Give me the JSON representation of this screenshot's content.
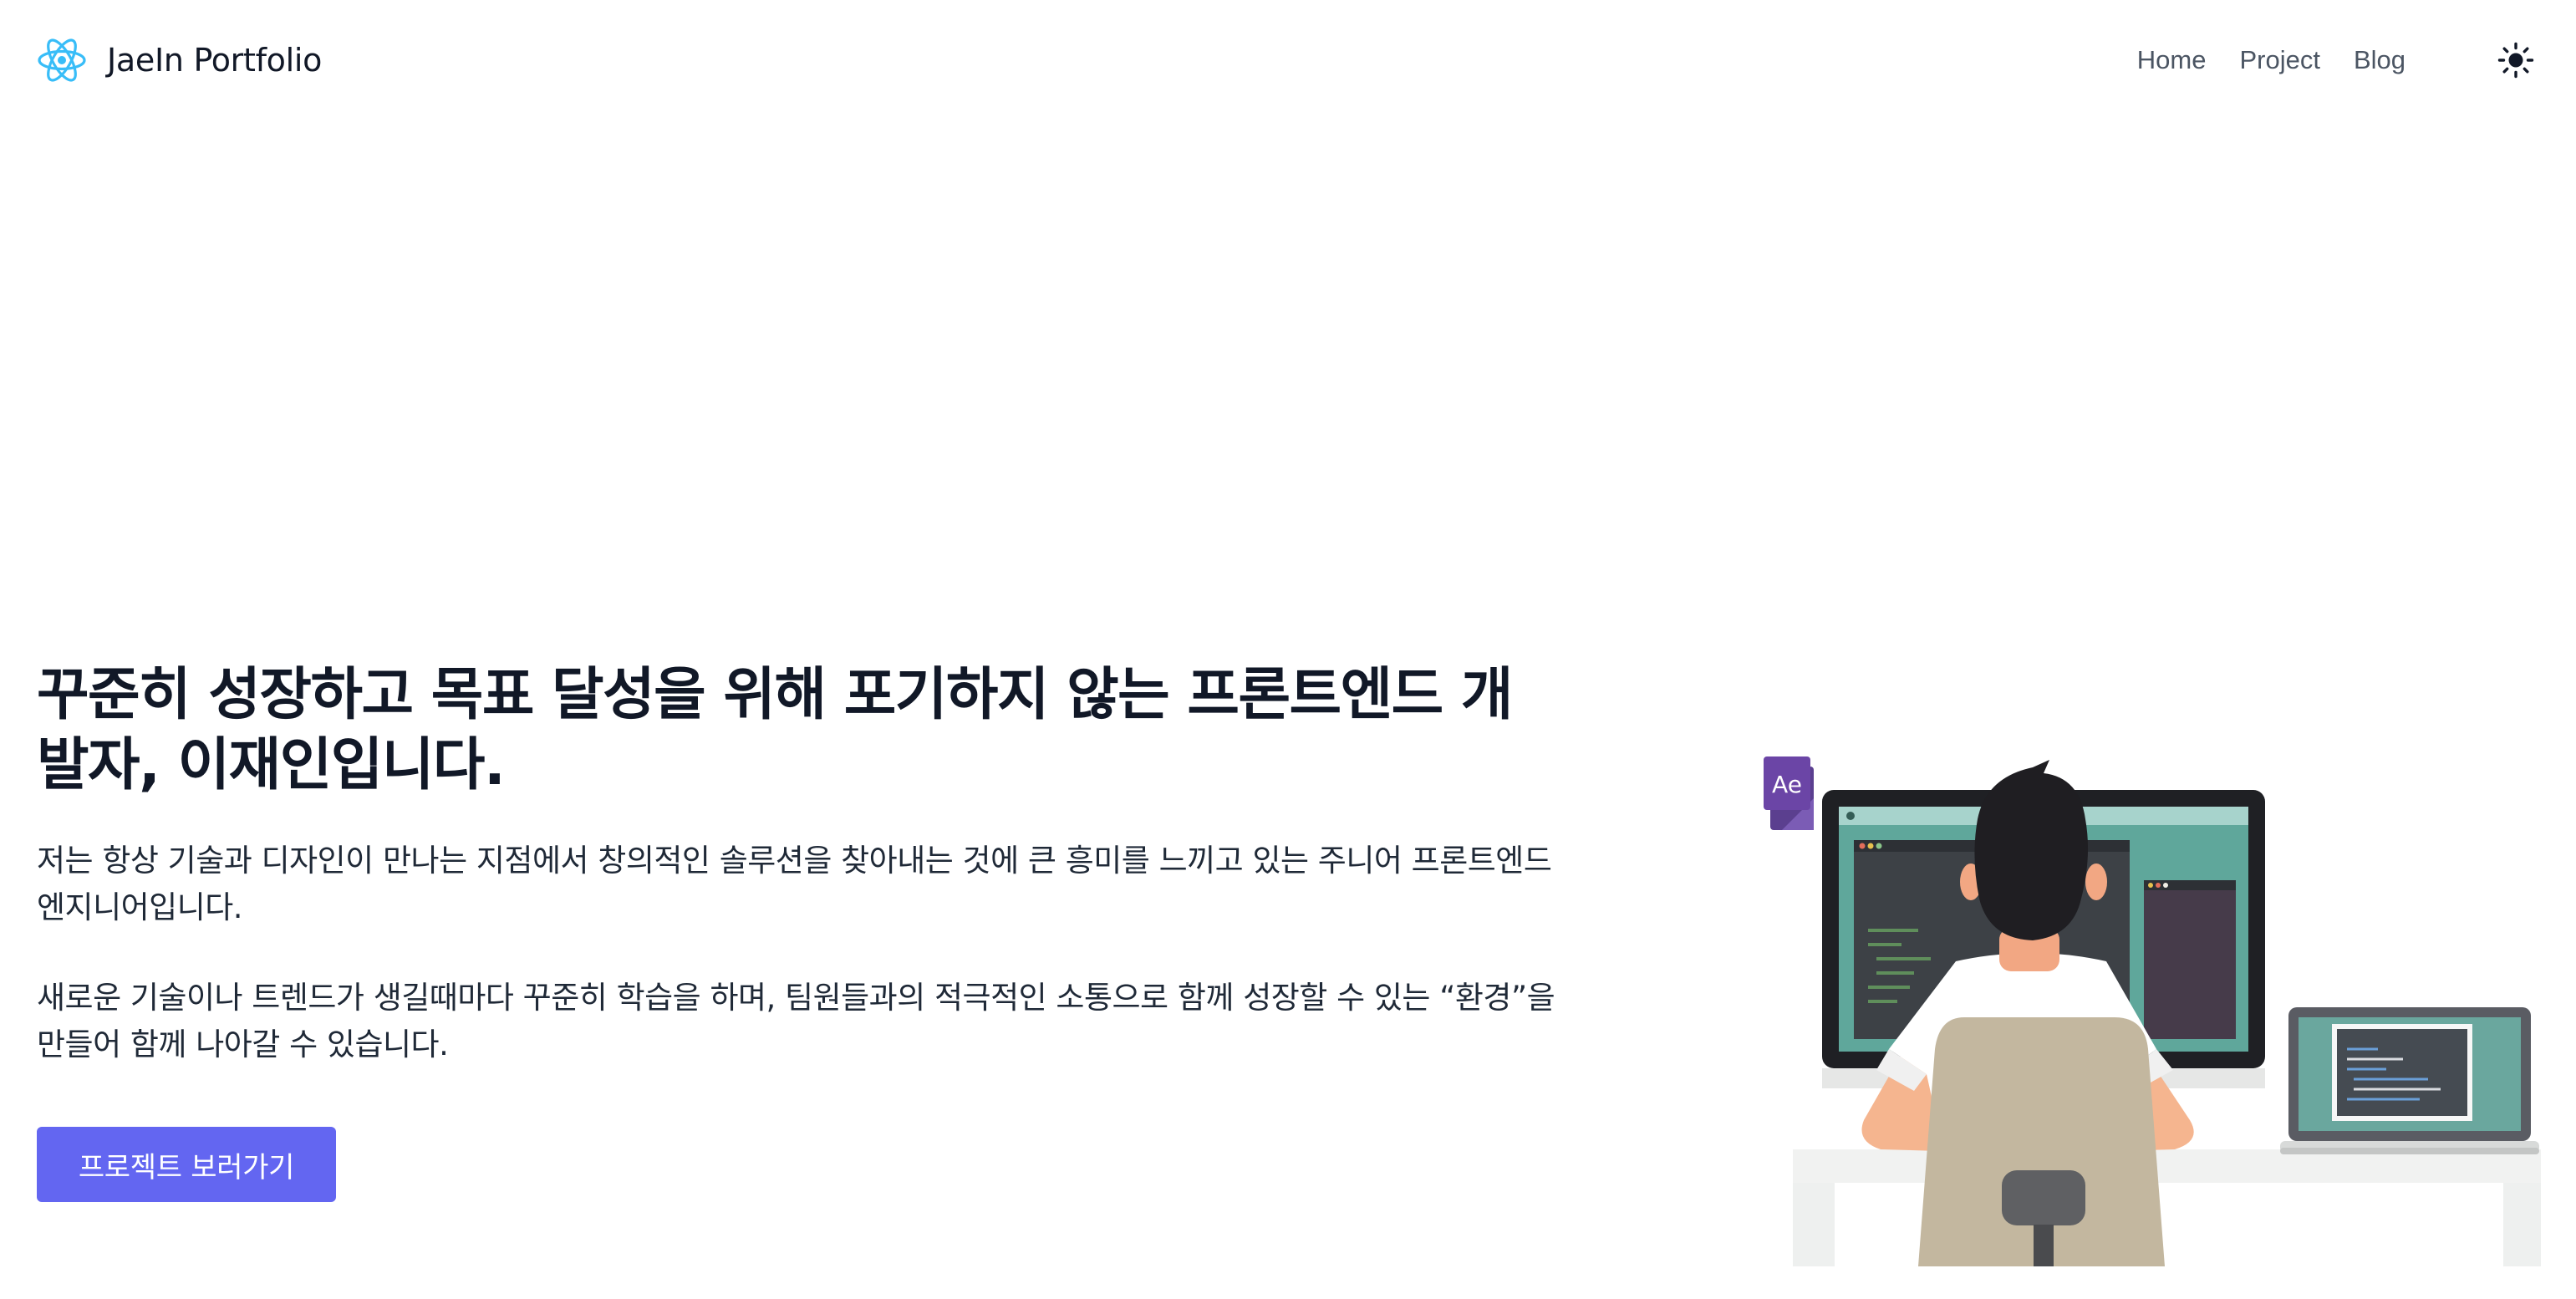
{
  "header": {
    "brand": {
      "title": "JaeIn Portfolio",
      "logo_icon": "react-atom-icon"
    },
    "nav": [
      {
        "label": "Home"
      },
      {
        "label": "Project"
      },
      {
        "label": "Blog"
      }
    ],
    "theme_toggle_icon": "sun-icon"
  },
  "hero": {
    "title": "꾸준히 성장하고 목표 달성을 위해 포기하지 않는 프론트엔드 개발자, 이재인입니다.",
    "paragraphs": [
      "저는 항상 기술과 디자인이 만나는 지점에서 창의적인 솔루션을 찾아내는 것에 큰 흥미를 느끼고 있는 주니어 프론트엔드 엔지니어입니다.",
      "새로운 기술이나 트렌드가 생길때마다 꾸준히 학습을 하며, 팀원들과의 적극적인 소통으로 함께 성장할 수 있는 “환경”을 만들어 함께 나아갈 수 있습니다."
    ],
    "cta_label": "프로젝트 보러가기",
    "illustration": {
      "badge_text": "Ae",
      "icon": "developer-at-desk-illustration"
    }
  },
  "colors": {
    "accent": "#6366f1",
    "logo": "#38bdf8",
    "nav_text": "#4b5563",
    "screen_teal": "#5fa79b"
  }
}
